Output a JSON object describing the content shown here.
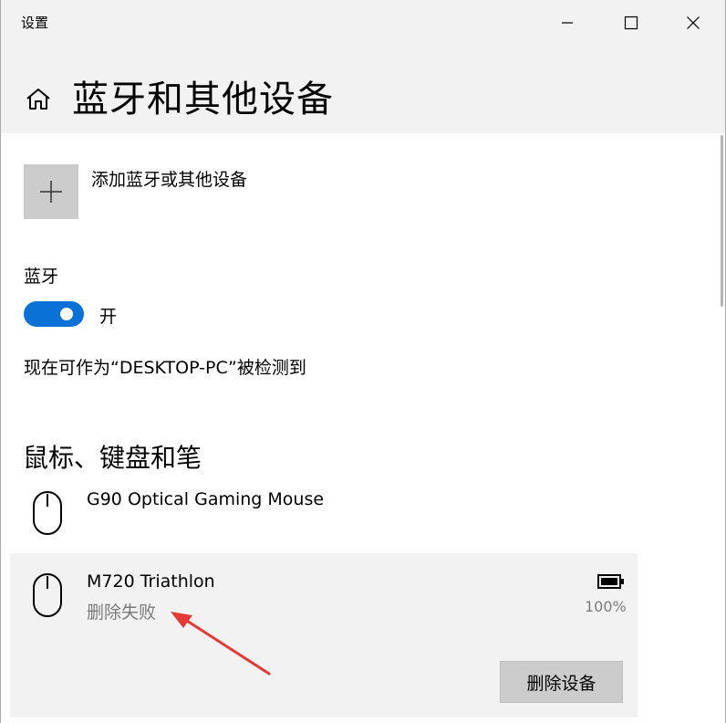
{
  "window": {
    "app_title": "设置",
    "minimize_icon": "minimize-icon",
    "maximize_icon": "maximize-icon",
    "close_icon": "close-icon"
  },
  "header": {
    "home_icon": "home-icon",
    "title": "蓝牙和其他设备"
  },
  "add_device": {
    "icon": "plus-icon",
    "label": "添加蓝牙或其他设备"
  },
  "bluetooth": {
    "label": "蓝牙",
    "toggle_on": true,
    "state_text": "开",
    "discoverable_text": "现在可作为“DESKTOP-PC”被检测到"
  },
  "section": {
    "title": "鼠标、键盘和笔"
  },
  "devices": [
    {
      "icon": "mouse-icon",
      "name": "G90 Optical Gaming Mouse"
    },
    {
      "icon": "mouse-icon",
      "name": "M720 Triathlon",
      "status": "删除失败",
      "battery_icon": "battery-icon",
      "battery": "100%",
      "remove_button": "删除设备"
    }
  ],
  "colors": {
    "accent": "#0a72d6",
    "header_bg": "#f2f2f2",
    "selected_bg": "#f2f2f2",
    "button_bg": "#cccccc",
    "annotation_arrow": "#e53935",
    "secondary_text": "#7a7a7a"
  }
}
